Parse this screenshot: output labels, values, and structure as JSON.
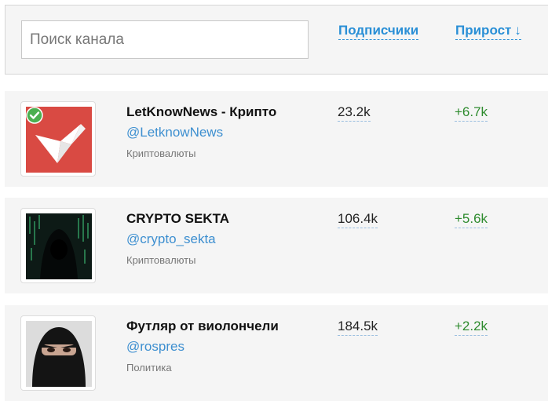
{
  "search": {
    "placeholder": "Поиск канала",
    "value": ""
  },
  "columns": {
    "subscribers_label": "Подписчики",
    "growth_label": "Прирост",
    "sort_arrow": "↓"
  },
  "channels": [
    {
      "name": "LetKnowNews - Крипто",
      "handle": "@LetknowNews",
      "category": "Криптовалюты",
      "subscribers": "23.2k",
      "growth": "+6.7k",
      "verified": true,
      "avatar_icon": "paper-bird-logo",
      "avatar_color": "#d94a43"
    },
    {
      "name": "CRYPTO SEKTA",
      "handle": "@crypto_sekta",
      "category": "Криптовалюты",
      "subscribers": "106.4k",
      "growth": "+5.6k",
      "verified": false,
      "avatar_icon": "hooded-hacker-avatar",
      "avatar_color": "#0d1a16"
    },
    {
      "name": "Футляр от виолончели",
      "handle": "@rospres",
      "category": "Политика",
      "subscribers": "184.5k",
      "growth": "+2.2k",
      "verified": false,
      "avatar_icon": "masked-face-avatar",
      "avatar_color": "#1a1a1a"
    }
  ],
  "colors": {
    "link": "#2a8fd6",
    "growth": "#2e8b2e",
    "verified": "#4caf50"
  }
}
